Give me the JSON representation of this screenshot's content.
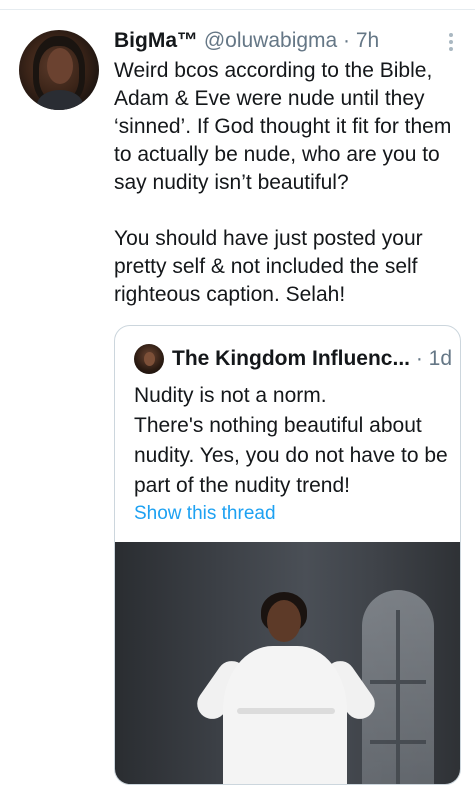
{
  "tweet": {
    "display_name": "BigMa™",
    "handle_time": " @oluwabigma · 7h",
    "text": "Weird bcos according to the Bible, Adam & Eve were nude until they ‘sinned’. If God thought it fit for them to actually be nude, who are you to say nudity isn’t beautiful?\n\nYou should have just posted your pretty self & not included the self righteous caption. Selah!"
  },
  "quote": {
    "display_name": "The Kingdom Influenc...",
    "time": " · 1d",
    "text": "Nudity is not a norm.\nThere's nothing beautiful about nudity. Yes, you do not have to be part of the nudity trend!",
    "show_thread": "Show this thread"
  },
  "icons": {
    "more": "more-vertical-icon"
  },
  "colors": {
    "link": "#1da1f2",
    "meta": "#657786",
    "border": "#ccd6dd"
  }
}
